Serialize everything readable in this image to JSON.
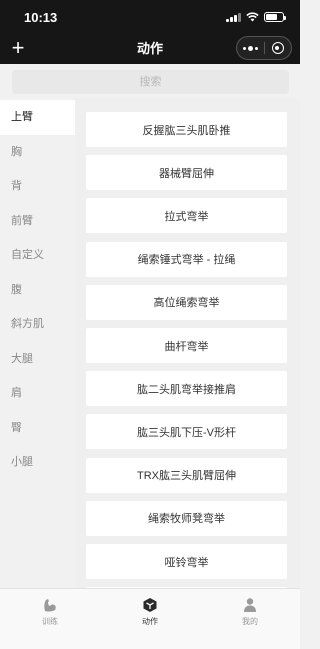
{
  "status_bar": {
    "time": "10:13",
    "signal_icon": "signal-icon",
    "wifi_icon": "wifi-icon",
    "battery_icon": "battery-icon"
  },
  "nav": {
    "add_icon": "plus-icon",
    "add_symbol": "+",
    "title": "动作",
    "more_icon": "more-dots-icon",
    "close_icon": "target-close-icon"
  },
  "search": {
    "placeholder": "搜索",
    "value": "",
    "icon": ""
  },
  "sidebar": {
    "items": [
      {
        "label": "上臂",
        "active": true
      },
      {
        "label": "胸",
        "active": false
      },
      {
        "label": "背",
        "active": false
      },
      {
        "label": "前臂",
        "active": false
      },
      {
        "label": "自定义",
        "active": false
      },
      {
        "label": "腹",
        "active": false
      },
      {
        "label": "斜方肌",
        "active": false
      },
      {
        "label": "大腿",
        "active": false
      },
      {
        "label": "肩",
        "active": false
      },
      {
        "label": "臀",
        "active": false
      },
      {
        "label": "小腿",
        "active": false
      }
    ]
  },
  "exercises": [
    "反握肱三头肌卧推",
    "器械臂屈伸",
    "拉式弯举",
    "绳索锤式弯举 - 拉绳",
    "高位绳索弯举",
    "曲杆弯举",
    "肱二头肌弯举接推肩",
    "肱三头肌下压-V形杆",
    "TRX肱三头肌臂屈伸",
    "绳索牧师凳弯举",
    "哑铃弯举"
  ],
  "tab_bar": {
    "tabs": [
      {
        "label": "训练",
        "icon": "arm-muscle-icon",
        "active": false
      },
      {
        "label": "动作",
        "icon": "cube-icon",
        "active": true
      },
      {
        "label": "我的",
        "icon": "person-icon",
        "active": false
      }
    ]
  },
  "colors": {
    "header_bg": "#161616",
    "page_bg": "#f1f1f1",
    "card_bg": "#ffffff",
    "inactive_text": "#888888",
    "active_text": "#222222"
  }
}
